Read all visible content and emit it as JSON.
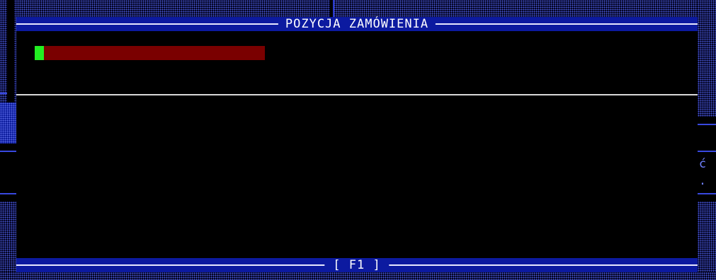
{
  "window": {
    "title": "POZYCJA ZAMÓWIENIA",
    "footer_hint": "[ F1 ]"
  },
  "progress": {
    "fraction": 0.04,
    "fill_color": "#22ee22",
    "track_color": "#7a0000"
  },
  "background": {
    "edge_glyph": "ć",
    "edge_dot": "."
  },
  "colors": {
    "title_bar": "#0c1aa0",
    "window_bg": "#000000",
    "pattern_dot": "#4a5ad8"
  }
}
